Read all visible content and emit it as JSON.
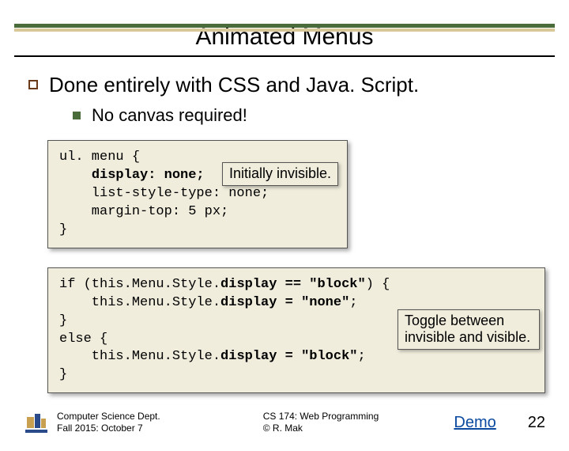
{
  "title": "Animated Menus",
  "bullet_main": "Done entirely with CSS and Java. Script.",
  "bullet_sub": "No canvas required!",
  "code1": {
    "l1": "ul. menu {",
    "l2p": "    ",
    "l2b": "display: none;",
    "l3": "    list-style-type: none;",
    "l4": "    margin-top: 5 px;",
    "l5": "}",
    "callout": "Initially invisible."
  },
  "code2": {
    "l1a": "if (this.Menu.Style.",
    "l1b": "display == \"block\"",
    "l1c": ") {",
    "l2a": "    this.Menu.Style.",
    "l2b": "display = \"none\"",
    "l2c": ";",
    "l3": "}",
    "l4": "else {",
    "l5a": "    this.Menu.Style.",
    "l5b": "display = \"block\"",
    "l5c": ";",
    "l6": "}",
    "callout_l1": "Toggle between",
    "callout_l2": "invisible and visible."
  },
  "footer": {
    "dept": "Computer Science Dept.",
    "term": "Fall 2015: October 7",
    "course": "CS 174: Web Programming",
    "author": "© R. Mak",
    "demo": "Demo",
    "page": "22"
  }
}
